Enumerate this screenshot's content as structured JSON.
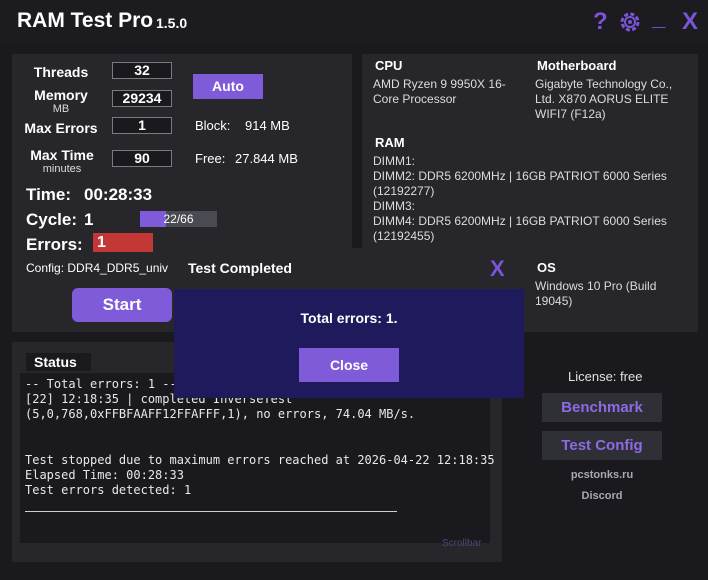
{
  "app": {
    "title": "RAM Test Pro",
    "version": "1.5.0"
  },
  "titlebar": {
    "help": "?",
    "settings_icon": "gear-icon",
    "minimize": "_",
    "close": "X"
  },
  "settings": {
    "threads_label": "Threads",
    "threads_value": "32",
    "memory_label": "Memory",
    "memory_unit": "MB",
    "memory_value": "29234",
    "max_errors_label": "Max Errors",
    "max_errors_value": "1",
    "max_time_label": "Max Time",
    "max_time_unit": "minutes",
    "max_time_value": "90",
    "auto_label": "Auto",
    "block_label": "Block:",
    "block_value": "914 MB",
    "free_label": "Free:",
    "free_value": "27.844 MB"
  },
  "progress": {
    "time_label": "Time:",
    "time_value": "00:28:33",
    "cycle_label": "Cycle:",
    "cycle_value": "1",
    "cycle_progress_text": "22/66",
    "cycle_fraction": 0.333,
    "errors_label": "Errors:",
    "errors_value": "1",
    "config_text": "Config: DDR4_DDR5_univ",
    "start_label": "Start"
  },
  "system": {
    "cpu_label": "CPU",
    "cpu_value": "AMD Ryzen 9 9950X 16-Core Processor",
    "mb_label": "Motherboard",
    "mb_value": "Gigabyte Technology Co., Ltd. X870 AORUS ELITE WIFI7 (F12a)",
    "ram_label": "RAM",
    "ram_lines": [
      "DIMM1:",
      "DIMM2: DDR5 6200MHz | 16GB PATRIOT 6000 Series",
      "(12192277)",
      "DIMM3:",
      "DIMM4: DDR5 6200MHz | 16GB PATRIOT 6000 Series",
      "(12192455)"
    ],
    "os_label": "OS",
    "os_value": "Windows 10 Pro (Build 19045)"
  },
  "status": {
    "title": "Status",
    "lines": [
      "-- Total errors: 1 --",
      "[22] 12:18:35 | completed InverseTest",
      "(5,0,768,0xFFBFAAFF12FFAFFF,1), no errors, 74.04 MB/s.",
      "",
      "",
      "Test stopped due to maximum errors reached at 2026-04-22 12:18:35",
      "Elapsed Time: 00:28:33",
      "Test errors detected: 1"
    ],
    "scrollbar_label": "Scrollbar"
  },
  "side": {
    "license_text": "License: free",
    "benchmark_label": "Benchmark",
    "test_config_label": "Test Config",
    "site_link": "pcstonks.ru",
    "discord_link": "Discord"
  },
  "dialog": {
    "title": "Test Completed",
    "close_x": "X",
    "message": "Total errors: 1.",
    "close_button": "Close"
  },
  "colors": {
    "accent": "#7f5bd9",
    "error": "#c43737",
    "dialog_bg": "#1f1a5c"
  }
}
